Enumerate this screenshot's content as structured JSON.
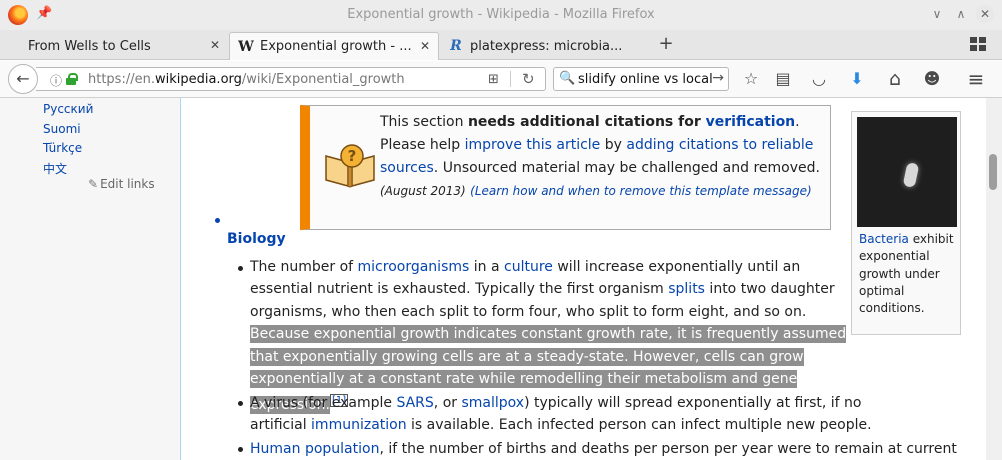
{
  "window": {
    "title": "Exponential growth - Wikipedia - Mozilla Firefox",
    "minimize_glyph": "∨",
    "maximize_glyph": "∧",
    "close_glyph": "✕"
  },
  "tabs": [
    {
      "label": "From Wells to Cells",
      "favicon": "",
      "active": false
    },
    {
      "label": "Exponential growth - ...",
      "favicon": "W",
      "active": true
    },
    {
      "label": "platexpress: microbia...",
      "favicon": "R",
      "active": false
    }
  ],
  "tab_close_glyph": "✕",
  "new_tab_glyph": "+",
  "nav": {
    "back_glyph": "←",
    "info_glyph": "ⓘ",
    "url_prefix": "https://en.",
    "url_domain": "wikipedia.org",
    "url_path": "/wiki/Exponential_growth",
    "reader_glyph": "⊞",
    "reload_glyph": "↻",
    "search_value": "slidify online vs local",
    "search_glyph": "🔍",
    "search_go_glyph": "→"
  },
  "toolbar_icons": [
    {
      "name": "bookmark-star-icon",
      "glyph": "☆"
    },
    {
      "name": "reading-list-icon",
      "glyph": "▤"
    },
    {
      "name": "pocket-icon",
      "glyph": "◡"
    },
    {
      "name": "downloads-icon",
      "glyph": "⬇"
    },
    {
      "name": "home-icon",
      "glyph": "⌂"
    },
    {
      "name": "chat-icon",
      "glyph": "☻"
    },
    {
      "name": "menu-icon",
      "glyph": "≡"
    }
  ],
  "sidebar": {
    "languages": [
      "Русский",
      "Suomi",
      "Türkçe",
      "中文"
    ],
    "edit_links": "Edit links",
    "pencil_glyph": "✎"
  },
  "ambox": {
    "t1": "This section ",
    "t2": "needs additional citations for ",
    "t3": "verification",
    "t4": ". Please help ",
    "t5": "improve this article",
    "t6": " by ",
    "t7": "adding citations to reliable sources",
    "t8": ". Unsourced material may be challenged and removed.",
    "date": "(August 2013)",
    "learn": "(Learn how and when to remove this template message)"
  },
  "thumb": {
    "caption_link": "Bacteria",
    "caption_rest": " exhibit exponential growth under optimal conditions."
  },
  "section": {
    "heading": "Biology"
  },
  "bullet1": {
    "a": "The number of ",
    "b": "microorganisms",
    "c": " in a ",
    "d": "culture",
    "e": " will increase exponentially until an essential nutrient is exhausted. Typically the first organism ",
    "f": "splits",
    "g": " into two daughter organisms, who then each split to form four, who split to form eight, and so on. ",
    "h": "Because exponential growth indicates constant growth rate, it is frequently assumed that exponentially growing cells are at a steady-state. However, cells can grow exponentially at a constant rate while remodelling their metabolism and gene expression.",
    "cite": "[1]"
  },
  "bullet2": {
    "a": "A virus (for example ",
    "b": "SARS",
    "c": ", or ",
    "d": "smallpox",
    "e": ") typically will spread exponentially at first, if no artificial ",
    "f": "immunization",
    "g": " is available. Each infected person can infect multiple new people."
  },
  "bullet3": {
    "a": "Human population",
    "b": ", if the number of births and deaths per person per year were to remain at current"
  }
}
